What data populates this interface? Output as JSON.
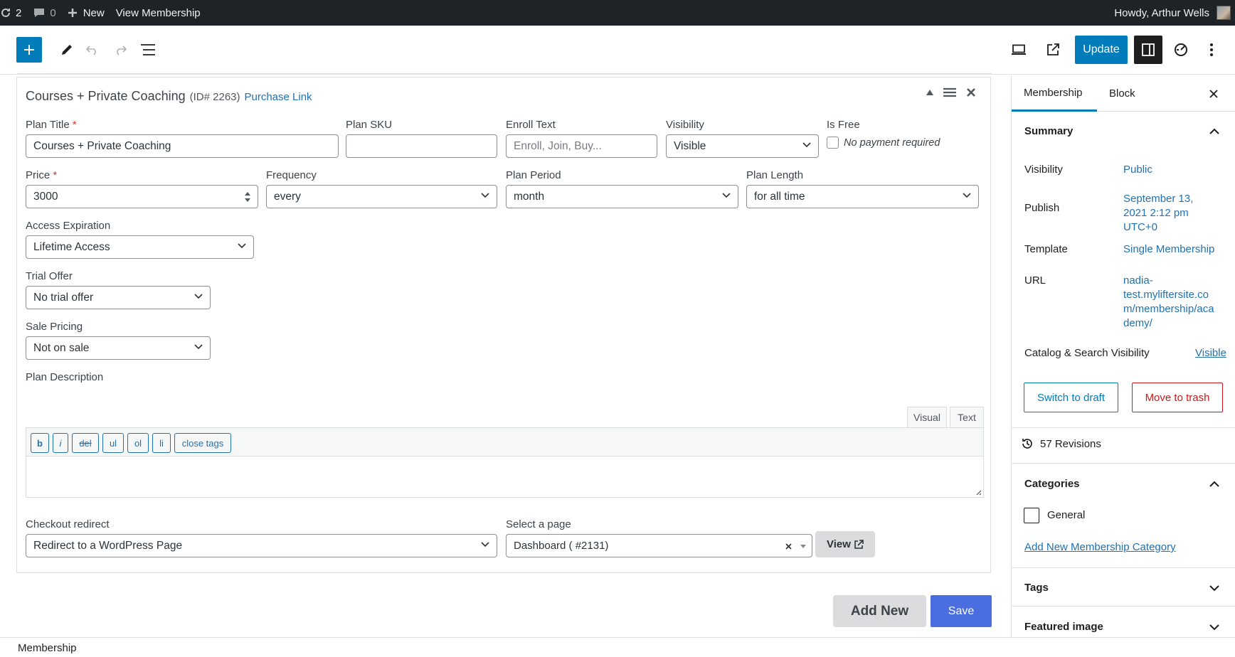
{
  "admin_bar": {
    "updates_count": "2",
    "comments_count": "0",
    "new_label": "New",
    "view_label": "View Membership",
    "greeting": "Howdy, Arthur Wells"
  },
  "toolbar": {
    "update_label": "Update"
  },
  "plan": {
    "title": "Courses + Private Coaching",
    "id_text": "(ID# 2263)",
    "purchase_link": "Purchase Link",
    "fields": {
      "plan_title_label": "Plan Title",
      "plan_title_value": "Courses + Private Coaching",
      "plan_sku_label": "Plan SKU",
      "plan_sku_value": "",
      "enroll_text_label": "Enroll Text",
      "enroll_text_placeholder": "Enroll, Join, Buy...",
      "visibility_label": "Visibility",
      "visibility_value": "Visible",
      "is_free_label": "Is Free",
      "is_free_text": "No payment required",
      "price_label": "Price",
      "price_value": "3000",
      "frequency_label": "Frequency",
      "frequency_value": "every",
      "plan_period_label": "Plan Period",
      "plan_period_value": "month",
      "plan_length_label": "Plan Length",
      "plan_length_value": "for all time",
      "access_expiration_label": "Access Expiration",
      "access_expiration_value": "Lifetime Access",
      "trial_offer_label": "Trial Offer",
      "trial_offer_value": "No trial offer",
      "sale_pricing_label": "Sale Pricing",
      "sale_pricing_value": "Not on sale",
      "plan_description_label": "Plan Description",
      "checkout_redirect_label": "Checkout redirect",
      "checkout_redirect_value": "Redirect to a WordPress Page",
      "select_page_label": "Select a page",
      "select_page_value": "Dashboard ( #2131)",
      "view_label": "View"
    },
    "editor": {
      "tab_visual": "Visual",
      "tab_text": "Text",
      "buttons": [
        "b",
        "i",
        "del",
        "ul",
        "ol",
        "li",
        "close tags"
      ]
    }
  },
  "actions": {
    "add_new": "Add New",
    "save": "Save"
  },
  "footer": {
    "breadcrumb": "Membership"
  },
  "sidebar": {
    "tab_membership": "Membership",
    "tab_block": "Block",
    "summary_title": "Summary",
    "visibility_label": "Visibility",
    "visibility_value": "Public",
    "publish_label": "Publish",
    "publish_value_1": "September 13,",
    "publish_value_2": "2021 2:12 pm",
    "publish_value_3": "UTC+0",
    "template_label": "Template",
    "template_value": "Single Membership",
    "url_label": "URL",
    "url_line_1": "nadia-",
    "url_line_2": "test.myliftersite.co",
    "url_line_3": "m/membership/aca",
    "url_line_4": "demy/",
    "catalog_label": "Catalog & Search Visibility",
    "catalog_value": "Visible",
    "switch_draft": "Switch to draft",
    "move_trash": "Move to trash",
    "revisions": "57 Revisions",
    "categories_title": "Categories",
    "category_general": "General",
    "add_category": "Add New Membership Category",
    "tags_title": "Tags",
    "featured_title": "Featured image"
  },
  "colors": {
    "accent": "#007cba",
    "link": "#2271b1",
    "danger": "#cc1818",
    "save": "#4a6ee0",
    "admin_bar": "#1d2327"
  }
}
